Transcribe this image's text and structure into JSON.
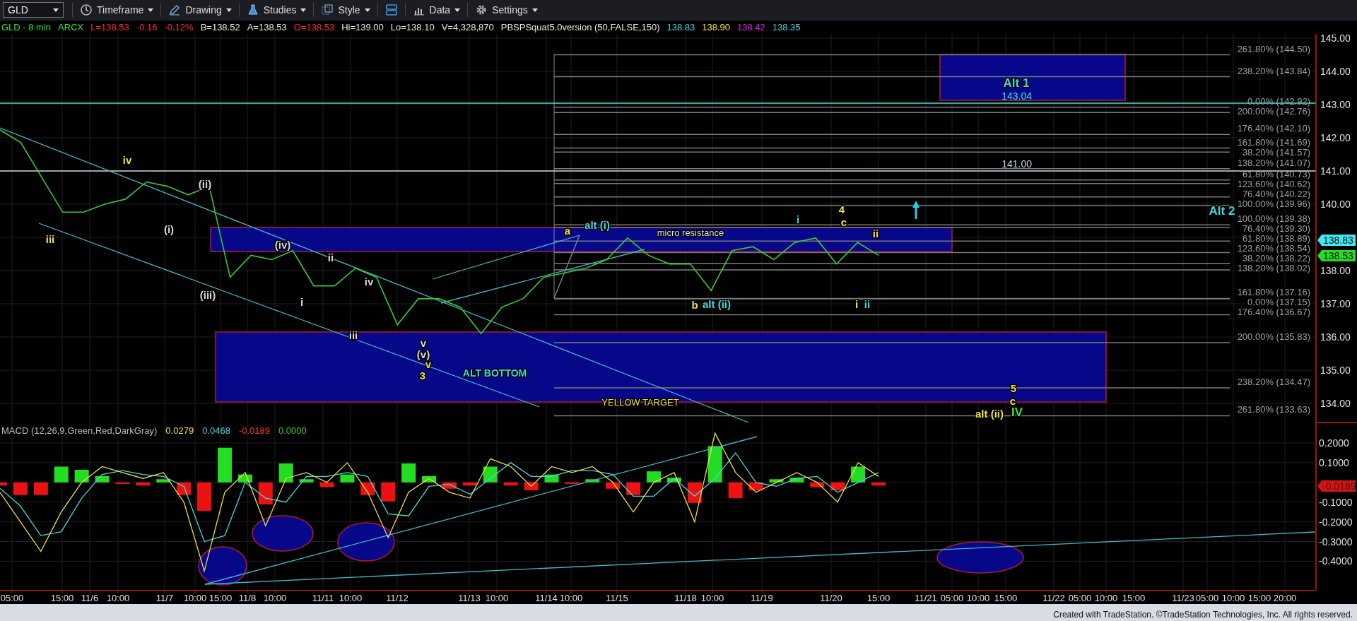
{
  "toolbar": {
    "symbol": "GLD",
    "menus": [
      "Timeframe",
      "Drawing",
      "Studies",
      "Style",
      "Data",
      "Settings"
    ]
  },
  "info_line": [
    {
      "text": "GLD - 8 min",
      "color": "#2ee62e"
    },
    {
      "text": "ARCX",
      "color": "#2ee62e"
    },
    {
      "text": "L=138.53",
      "color": "#ff2a2a"
    },
    {
      "text": "-0.16",
      "color": "#ff2a2a"
    },
    {
      "text": "-0.12%",
      "color": "#ff2a2a"
    },
    {
      "text": "B=138.52",
      "color": "#e8e8e8"
    },
    {
      "text": "A=138.53",
      "color": "#e8e8e8"
    },
    {
      "text": "O=138.53",
      "color": "#ff2a2a"
    },
    {
      "text": "Hi=139.00",
      "color": "#e8e8e8"
    },
    {
      "text": "Lo=138.10",
      "color": "#e8e8e8"
    },
    {
      "text": "V=4,328,870",
      "color": "#e8e8e8"
    },
    {
      "text": "PBSPSquat5.0version (50,FALSE,150)",
      "color": "#e8e8e8"
    },
    {
      "text": "138.83",
      "color": "#40d8e0"
    },
    {
      "text": "138.90",
      "color": "#f0e040"
    },
    {
      "text": "138.42",
      "color": "#e020e0"
    },
    {
      "text": "138.35",
      "color": "#40d8e0"
    }
  ],
  "price_pane": {
    "axis_labels": [
      "145.00",
      "144.00",
      "143.00",
      "142.00",
      "141.00",
      "140.00",
      "138.00",
      "137.00",
      "136.00",
      "135.00",
      "134.00"
    ],
    "line_labels": [
      {
        "text": "143.04",
        "color": "#40e0d0"
      },
      {
        "text": "141.00",
        "color": "#c8d8e8"
      }
    ],
    "fib_labels": [
      "261.80% (144.50)",
      "238.20% (143.84)",
      "0.00% (142.92)",
      "200.00% (142.76)",
      "176.40% (142.10)",
      "161.80% (141.69)",
      "38.20% (141.57)",
      "138.20% (141.07)",
      "61.80% (140.73)",
      "123.60% (140.62)",
      "76.40% (140.22)",
      "100.00% (139.96)",
      "100.00% (139.38)",
      "76.40% (139.30)",
      "61.80% (138.89)",
      "123.60% (138.54)",
      "38.20% (138.22)",
      "138.20% (138.02)",
      "161.80% (137.16)",
      "0.00% (137.15)",
      "176.40% (136.67)",
      "200.00% (135.83)",
      "238.20% (134.47)",
      "261.80% (133.63)"
    ],
    "labels": [
      {
        "text": "iii",
        "color": "#f0e040"
      },
      {
        "text": "iv",
        "color": "#f0e040"
      },
      {
        "text": "(ii)",
        "color": "#d8d8d8"
      },
      {
        "text": "(i)",
        "color": "#d8d8d8"
      },
      {
        "text": "(iii)",
        "color": "#d8d8d8"
      },
      {
        "text": "(iv)",
        "color": "#d8d8d8"
      },
      {
        "text": "ii",
        "color": "#d8d8d8"
      },
      {
        "text": "i",
        "color": "#d8d8d8"
      },
      {
        "text": "iv",
        "color": "#d8d8d8"
      },
      {
        "text": "iii",
        "color": "#d8d8d8"
      },
      {
        "text": "v",
        "color": "#d8d8d8"
      },
      {
        "text": "(v)",
        "color": "#d8d8d8"
      },
      {
        "text": "v",
        "color": "#f0e040"
      },
      {
        "text": "3",
        "color": "#f0e040"
      },
      {
        "text": "ALT BOTTOM",
        "color": "#40d8e0"
      },
      {
        "text": "YELLOW TARGET",
        "color": "#f0e040"
      },
      {
        "text": "a",
        "color": "#f0e040"
      },
      {
        "text": "alt (i)",
        "color": "#40d8e0"
      },
      {
        "text": "micro resistance",
        "color": "#d8e0f0"
      },
      {
        "text": "b",
        "color": "#f0e040"
      },
      {
        "text": "alt (ii)",
        "color": "#40d8e0"
      },
      {
        "text": "i",
        "color": "#40d8e0"
      },
      {
        "text": "4",
        "color": "#f0e040"
      },
      {
        "text": "c",
        "color": "#f0e040"
      },
      {
        "text": "ii",
        "color": "#f0e040"
      },
      {
        "text": "i",
        "color": "#f0e040"
      },
      {
        "text": "ii",
        "color": "#40d8e0"
      },
      {
        "text": "Alt 1",
        "color": "#40d8e0"
      },
      {
        "text": "Alt 2",
        "color": "#40d8e0"
      },
      {
        "text": "5",
        "color": "#f0e040"
      },
      {
        "text": "c",
        "color": "#f0e040"
      },
      {
        "text": "alt (ii)",
        "color": "#f0e040"
      },
      {
        "text": "IV",
        "color": "#40e040"
      }
    ],
    "last_prices": [
      {
        "text": "138.83",
        "color": "#40e8f0"
      },
      {
        "text": "138.53",
        "color": "#22dd22"
      }
    ]
  },
  "macd_pane": {
    "title": "MACD (12,26,9,Green,Red,DarkGray)",
    "readings": [
      {
        "text": "0.0279",
        "color": "#f0e040"
      },
      {
        "text": "0.0468",
        "color": "#40d8e0"
      },
      {
        "text": "-0.0189",
        "color": "#ff3030"
      },
      {
        "text": "0.0000",
        "color": "#30d030"
      }
    ],
    "axis_labels": [
      "0.2000",
      "0.1000",
      "-0.1000",
      "-0.2000",
      "-0.3000",
      "-0.4000"
    ],
    "last_value": "-0.0189"
  },
  "time_axis": [
    "05:00",
    "15:00",
    "11/6",
    "10:00",
    "11/7",
    "10:00",
    "15:00",
    "11/8",
    "10:00",
    "11/11",
    "10:00",
    "11/12",
    "11/13",
    "10:00",
    "11/14",
    "10:00",
    "11/15",
    "11/18",
    "10:00",
    "11/19",
    "11/20",
    "15:00",
    "11/21",
    "05:00",
    "10:00",
    "15:00",
    "11/22",
    "05:00",
    "10:00",
    "15:00",
    "11/23",
    "05:00",
    "10:00",
    "15:00",
    "20:00"
  ],
  "footer": "Created with TradeStation. ©TradeStation Technologies, Inc. All rights reserved."
}
